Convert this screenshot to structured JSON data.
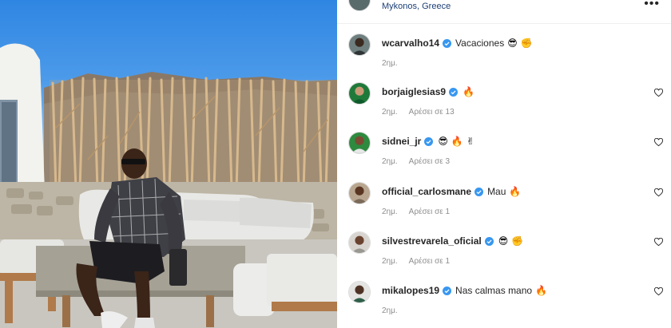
{
  "post": {
    "location": "Mykonos, Greece"
  },
  "comments": [
    {
      "username": "wcarvalho14",
      "verified": true,
      "text": "Vacaciones",
      "emojis": [
        "😎",
        "✊"
      ],
      "time": "2ημ.",
      "likes": ""
    },
    {
      "username": "borjaiglesias9",
      "verified": true,
      "text": "",
      "emojis": [
        "🔥"
      ],
      "time": "2ημ.",
      "likes": "Αρέσει σε 13"
    },
    {
      "username": "sidnei_jr",
      "verified": true,
      "text": "",
      "emojis": [
        "😎",
        "🔥",
        "✌"
      ],
      "time": "2ημ.",
      "likes": "Αρέσει σε 3"
    },
    {
      "username": "official_carlosmane",
      "verified": true,
      "text": "Mau",
      "emojis": [
        "🔥"
      ],
      "time": "2ημ.",
      "likes": "Αρέσει σε 1"
    },
    {
      "username": "silvestrevarela_oficial",
      "verified": true,
      "text": "",
      "emojis": [
        "😎",
        "✊"
      ],
      "time": "2ημ.",
      "likes": "Αρέσει σε 1"
    },
    {
      "username": "mikalopes19",
      "verified": true,
      "text": "Nas calmas mano",
      "emojis": [
        "🔥"
      ],
      "time": "2ημ.",
      "likes": ""
    }
  ],
  "colors": {
    "verified": "#3897f0",
    "location": "#1c3f77",
    "meta": "#8e8e8e",
    "fire": "#f28c1e"
  }
}
